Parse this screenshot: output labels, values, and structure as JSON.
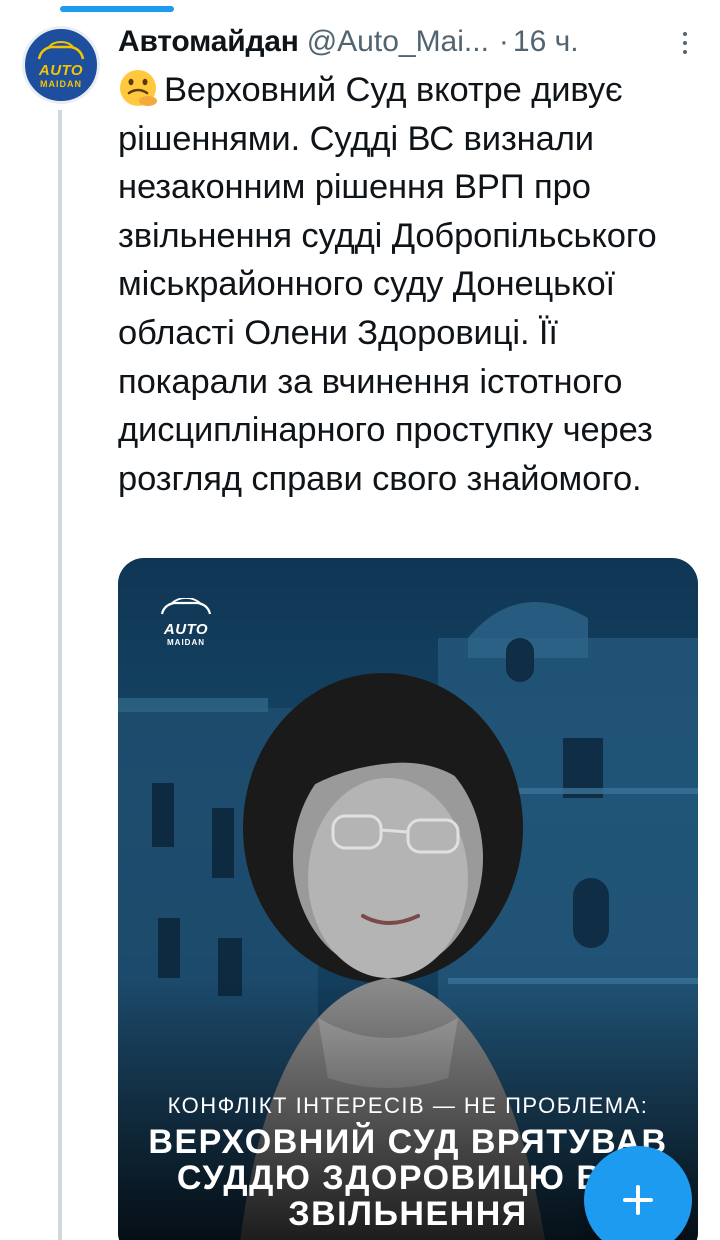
{
  "tweet": {
    "author_name": "Автомайдан",
    "author_handle": "@Auto_Mai...",
    "separator": "·",
    "time": "16 ч.",
    "avatar_logo_top": "AUTO",
    "avatar_logo_bottom": "MAIDAN",
    "emoji": "slightly-smiling-upside-face",
    "text": "Верховний Суд вкотре дивує рішеннями. Судді ВС визнали незаконним рішення ВРП про звільнення судді Добропільського міськрайонного суду Донецької області Олени Здоровиці. Її покарали за вчинення істотного дисциплінарного проступку через розгляд справи свого знайомого."
  },
  "media": {
    "logo_top": "AUTO",
    "logo_bottom": "MAIDAN",
    "subtitle": "КОНФЛІКТ ІНТЕРЕСІВ — НЕ ПРОБЛЕМА:",
    "headline_line1": "ВЕРХОВНИЙ СУД ВРЯТУВАВ",
    "headline_line2": "СУДДЮ ЗДОРОВИЦЮ ВІД",
    "headline_line3": "ЗВІЛЬНЕННЯ"
  },
  "colors": {
    "accent": "#1d9bf0",
    "brand_avatar": "#1d4f9e",
    "logo_yellow": "#f5c400",
    "text": "#0f1419",
    "muted": "#536471"
  },
  "icons": {
    "more": "more-vertical-icon",
    "compose": "plus-icon"
  }
}
